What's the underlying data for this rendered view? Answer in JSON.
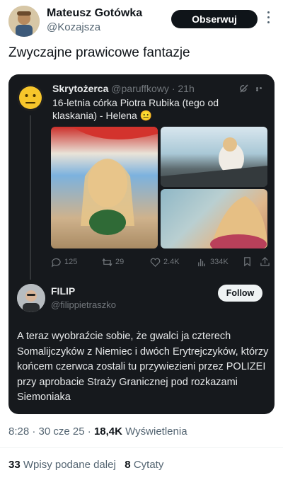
{
  "tweet": {
    "author_name": "Mateusz Gotówka",
    "author_handle": "@Kozajsza",
    "follow_label": "Obserwuj",
    "text": "Zwyczajne prawicowe fantazje",
    "time": "8:28",
    "date": "30 cze 25",
    "views_count": "18,4K",
    "views_label": "Wyświetlenia",
    "retweets_count": "33",
    "retweets_label": "Wpisy podane dalej",
    "quotes_count": "8",
    "quotes_label": "Cytaty"
  },
  "quoted": {
    "author_name": "Skrytożerca",
    "author_handle": "@paruffkowy",
    "time": "21h",
    "text": "16-letnia córka Piotra Rubika (tego od klaskania) - Helena 😐",
    "avatar_emoji": "😐",
    "stats": {
      "replies": "125",
      "retweets": "29",
      "likes": "2.4K",
      "views": "334K"
    }
  },
  "reply": {
    "author_name": "FILIP",
    "author_handle": "@filippietraszko",
    "follow_label": "Follow",
    "text": "A teraz wyobraźcie sobie, że gwalci ja czterech Somalijczyków z Niemiec i dwóch Erytrejczyków, którzy końcem czerwca zostali tu przywiezieni przez POLIZEI przy aprobacie Straży Granicznej pod rozkazami Siemoniaka"
  }
}
